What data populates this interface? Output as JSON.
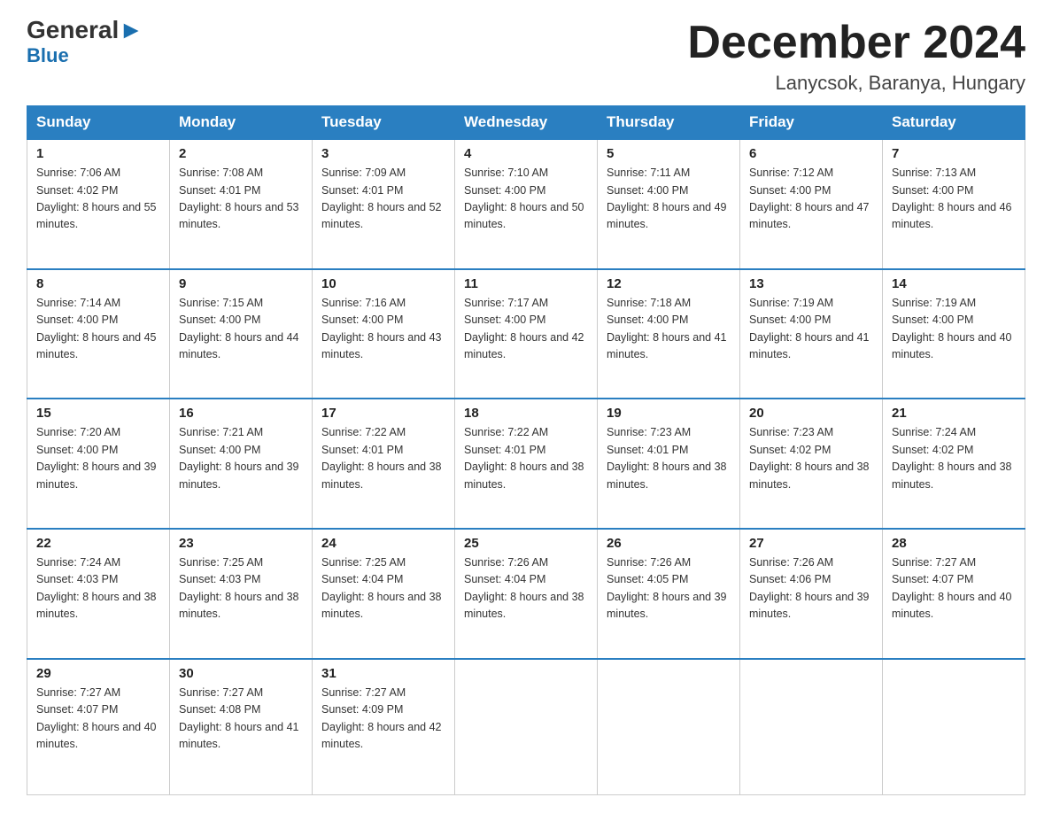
{
  "header": {
    "logo_general": "General",
    "logo_blue": "Blue",
    "month_title": "December 2024",
    "location": "Lanycsok, Baranya, Hungary"
  },
  "days_of_week": [
    "Sunday",
    "Monday",
    "Tuesday",
    "Wednesday",
    "Thursday",
    "Friday",
    "Saturday"
  ],
  "weeks": [
    [
      {
        "day": "1",
        "sunrise": "7:06 AM",
        "sunset": "4:02 PM",
        "daylight": "8 hours and 55 minutes."
      },
      {
        "day": "2",
        "sunrise": "7:08 AM",
        "sunset": "4:01 PM",
        "daylight": "8 hours and 53 minutes."
      },
      {
        "day": "3",
        "sunrise": "7:09 AM",
        "sunset": "4:01 PM",
        "daylight": "8 hours and 52 minutes."
      },
      {
        "day": "4",
        "sunrise": "7:10 AM",
        "sunset": "4:00 PM",
        "daylight": "8 hours and 50 minutes."
      },
      {
        "day": "5",
        "sunrise": "7:11 AM",
        "sunset": "4:00 PM",
        "daylight": "8 hours and 49 minutes."
      },
      {
        "day": "6",
        "sunrise": "7:12 AM",
        "sunset": "4:00 PM",
        "daylight": "8 hours and 47 minutes."
      },
      {
        "day": "7",
        "sunrise": "7:13 AM",
        "sunset": "4:00 PM",
        "daylight": "8 hours and 46 minutes."
      }
    ],
    [
      {
        "day": "8",
        "sunrise": "7:14 AM",
        "sunset": "4:00 PM",
        "daylight": "8 hours and 45 minutes."
      },
      {
        "day": "9",
        "sunrise": "7:15 AM",
        "sunset": "4:00 PM",
        "daylight": "8 hours and 44 minutes."
      },
      {
        "day": "10",
        "sunrise": "7:16 AM",
        "sunset": "4:00 PM",
        "daylight": "8 hours and 43 minutes."
      },
      {
        "day": "11",
        "sunrise": "7:17 AM",
        "sunset": "4:00 PM",
        "daylight": "8 hours and 42 minutes."
      },
      {
        "day": "12",
        "sunrise": "7:18 AM",
        "sunset": "4:00 PM",
        "daylight": "8 hours and 41 minutes."
      },
      {
        "day": "13",
        "sunrise": "7:19 AM",
        "sunset": "4:00 PM",
        "daylight": "8 hours and 41 minutes."
      },
      {
        "day": "14",
        "sunrise": "7:19 AM",
        "sunset": "4:00 PM",
        "daylight": "8 hours and 40 minutes."
      }
    ],
    [
      {
        "day": "15",
        "sunrise": "7:20 AM",
        "sunset": "4:00 PM",
        "daylight": "8 hours and 39 minutes."
      },
      {
        "day": "16",
        "sunrise": "7:21 AM",
        "sunset": "4:00 PM",
        "daylight": "8 hours and 39 minutes."
      },
      {
        "day": "17",
        "sunrise": "7:22 AM",
        "sunset": "4:01 PM",
        "daylight": "8 hours and 38 minutes."
      },
      {
        "day": "18",
        "sunrise": "7:22 AM",
        "sunset": "4:01 PM",
        "daylight": "8 hours and 38 minutes."
      },
      {
        "day": "19",
        "sunrise": "7:23 AM",
        "sunset": "4:01 PM",
        "daylight": "8 hours and 38 minutes."
      },
      {
        "day": "20",
        "sunrise": "7:23 AM",
        "sunset": "4:02 PM",
        "daylight": "8 hours and 38 minutes."
      },
      {
        "day": "21",
        "sunrise": "7:24 AM",
        "sunset": "4:02 PM",
        "daylight": "8 hours and 38 minutes."
      }
    ],
    [
      {
        "day": "22",
        "sunrise": "7:24 AM",
        "sunset": "4:03 PM",
        "daylight": "8 hours and 38 minutes."
      },
      {
        "day": "23",
        "sunrise": "7:25 AM",
        "sunset": "4:03 PM",
        "daylight": "8 hours and 38 minutes."
      },
      {
        "day": "24",
        "sunrise": "7:25 AM",
        "sunset": "4:04 PM",
        "daylight": "8 hours and 38 minutes."
      },
      {
        "day": "25",
        "sunrise": "7:26 AM",
        "sunset": "4:04 PM",
        "daylight": "8 hours and 38 minutes."
      },
      {
        "day": "26",
        "sunrise": "7:26 AM",
        "sunset": "4:05 PM",
        "daylight": "8 hours and 39 minutes."
      },
      {
        "day": "27",
        "sunrise": "7:26 AM",
        "sunset": "4:06 PM",
        "daylight": "8 hours and 39 minutes."
      },
      {
        "day": "28",
        "sunrise": "7:27 AM",
        "sunset": "4:07 PM",
        "daylight": "8 hours and 40 minutes."
      }
    ],
    [
      {
        "day": "29",
        "sunrise": "7:27 AM",
        "sunset": "4:07 PM",
        "daylight": "8 hours and 40 minutes."
      },
      {
        "day": "30",
        "sunrise": "7:27 AM",
        "sunset": "4:08 PM",
        "daylight": "8 hours and 41 minutes."
      },
      {
        "day": "31",
        "sunrise": "7:27 AM",
        "sunset": "4:09 PM",
        "daylight": "8 hours and 42 minutes."
      },
      null,
      null,
      null,
      null
    ]
  ]
}
